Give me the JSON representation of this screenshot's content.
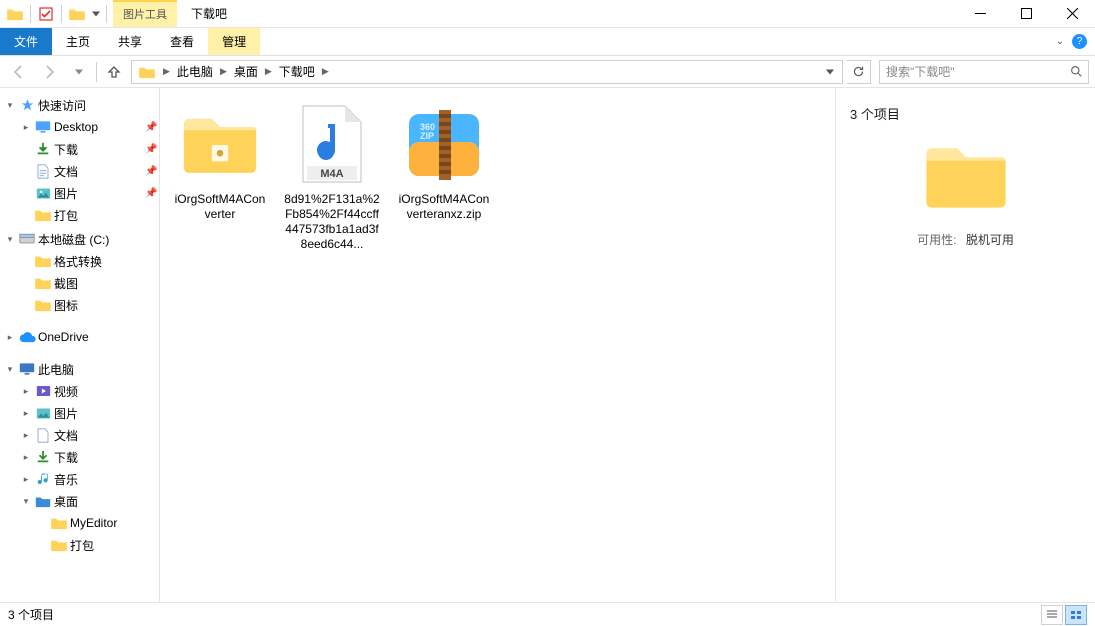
{
  "window": {
    "context_tab": "图片工具",
    "title": "下载吧"
  },
  "ribbon": {
    "file": "文件",
    "home": "主页",
    "share": "共享",
    "view": "查看",
    "manage": "管理"
  },
  "nav": {
    "breadcrumbs": [
      "此电脑",
      "桌面",
      "下载吧"
    ],
    "search_placeholder": "搜索\"下载吧\""
  },
  "sidebar": {
    "quick_access": "快速访问",
    "quick": [
      {
        "label": "Desktop",
        "icon": "desktop",
        "pinned": true
      },
      {
        "label": "下载",
        "icon": "download",
        "pinned": true
      },
      {
        "label": "文档",
        "icon": "document",
        "pinned": true
      },
      {
        "label": "图片",
        "icon": "picture",
        "pinned": true
      },
      {
        "label": "打包",
        "icon": "folder",
        "pinned": false
      }
    ],
    "local_disk": "本地磁盘 (C:)",
    "local": [
      {
        "label": "格式转换"
      },
      {
        "label": "截图"
      },
      {
        "label": "图标"
      }
    ],
    "onedrive": "OneDrive",
    "this_pc": "此电脑",
    "pc": [
      {
        "label": "视频",
        "icon": "video"
      },
      {
        "label": "图片",
        "icon": "picture"
      },
      {
        "label": "文档",
        "icon": "document"
      },
      {
        "label": "下载",
        "icon": "download"
      },
      {
        "label": "音乐",
        "icon": "music"
      },
      {
        "label": "桌面",
        "icon": "desktop-folder"
      }
    ],
    "desktop_children": [
      {
        "label": "MyEditor"
      },
      {
        "label": "打包"
      }
    ]
  },
  "items_count_header": "3 个项目",
  "files": [
    {
      "name": "iOrgSoftM4AConverter",
      "type": "folder"
    },
    {
      "name": "8d91%2F131a%2Fb854%2Ff44ccff447573fb1a1ad3f8eed6c44...",
      "type": "m4a"
    },
    {
      "name": "iOrgSoftM4AConverteranxz.zip",
      "type": "zip"
    }
  ],
  "details": {
    "availability_label": "可用性:",
    "availability_value": "脱机可用"
  },
  "status": {
    "count": "3 个项目"
  }
}
